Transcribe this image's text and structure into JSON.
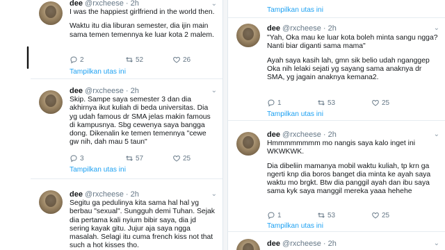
{
  "left": {
    "top_tweet": {
      "author": "dee",
      "handle": "@rxcheese",
      "time": "2h",
      "text_1": "I was the happiest girlfriend in the world then.",
      "text_2": "Waktu itu dia liburan semester, dia ijin main sama temen temennya ke luar kota 2 malem.",
      "replies": "2",
      "retweets": "52",
      "likes": "26",
      "thread_link": "Tampilkan utas ini",
      "annotation": "13"
    },
    "mid_tweet": {
      "author": "dee",
      "handle": "@rxcheese",
      "time": "2h",
      "text_1": "Skip. Sampe saya semester 3 dan dia akhirnya ikut kuliah di beda universitas. Dia yg udah famous dr SMA jelas makin famous di kampusnya. Sbg cewenya saya bangga dong. Dikenalin ke temen temennya \"cewe gw nih, dah mau 5 taun\"",
      "replies": "3",
      "retweets": "57",
      "likes": "25",
      "thread_link": "Tampilkan utas ini",
      "annotation": "12"
    },
    "bottom_tweet": {
      "author": "dee",
      "handle": "@rxcheese",
      "time": "2h",
      "text_1": "Segitu ga pedulinya kita sama hal hal yg berbau \"sexual\". Sungguh demi Tuhan. Sejak dia pertama kali nyium bibir saya, dia jd sering kayak gitu. Jujur aja saya ngga masalah. Selagi itu cuma french kiss not that such a hot kisses tho.",
      "annotation": "11"
    }
  },
  "right": {
    "top_link": "Tampilkan utas ini",
    "mid_tweet": {
      "author": "dee",
      "handle": "@rxcheese",
      "time": "2h",
      "text_1": "\"Yah, Oka mau ke luar kota boleh minta sangu ngga? Nanti biar diganti sama mama\"",
      "text_2": "Ayah saya kasih lah, gmn sik belio udah nganggep Oka nih lelaki sejati yg sayang sama anaknya dr SMA, yg jagain anaknya kemana2.",
      "replies": "1",
      "retweets": "53",
      "likes": "25",
      "thread_link": "Tampilkan utas ini",
      "annotation": "15"
    },
    "low_tweet": {
      "author": "dee",
      "handle": "@rxcheese",
      "time": "2h",
      "text_1": "Hmmmmmmmm mo nangis saya kalo inget ini WKWKWK.",
      "text_2": "Dia dibeliin mamanya mobil waktu kuliah, tp krn ga ngerti knp dia boros banget dia minta ke ayah saya waktu mo brgkt. Btw dia panggil ayah dan ibu saya sama kyk saya manggil mereka yaaa hehehe",
      "replies": "1",
      "retweets": "53",
      "likes": "25",
      "thread_link": "Tampilkan utas ini",
      "annotation": "14"
    },
    "last_tweet": {
      "author": "dee",
      "handle": "@rxcheese",
      "time": "2h"
    }
  },
  "icons": [
    "reply-icon",
    "retweet-icon",
    "like-icon",
    "chevron-down-icon"
  ],
  "colors": {
    "link": "#1da1f2",
    "muted": "#657786",
    "text": "#14171a",
    "separator": "#e6ecf0"
  }
}
